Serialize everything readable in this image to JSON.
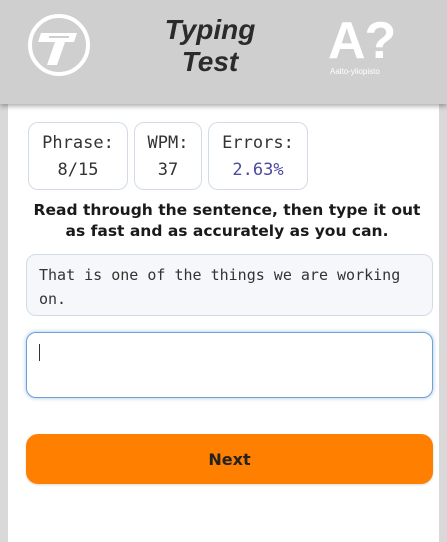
{
  "header": {
    "title_line1": "Typing",
    "title_line2": "Test",
    "aalto_mark": "A?",
    "aalto_text": "Aalto-yliopisto",
    "logo_icon": "typing-test-t-logo"
  },
  "stats": {
    "phrase_label": "Phrase:",
    "phrase_value": "8/15",
    "wpm_label": "WPM:",
    "wpm_value": "37",
    "errors_label": "Errors:",
    "errors_value": "2.63%"
  },
  "instruction": "Read through the sentence, then type it out as fast and as accurately as you can.",
  "phrase": "That is one of the things we are working on.",
  "input": {
    "value": ""
  },
  "next_label": "Next",
  "colors": {
    "header_bg": "#cfcfcf",
    "accent": "#ff7f00",
    "errors_value": "#4a4aa0",
    "input_focus": "#6fa1d6"
  }
}
